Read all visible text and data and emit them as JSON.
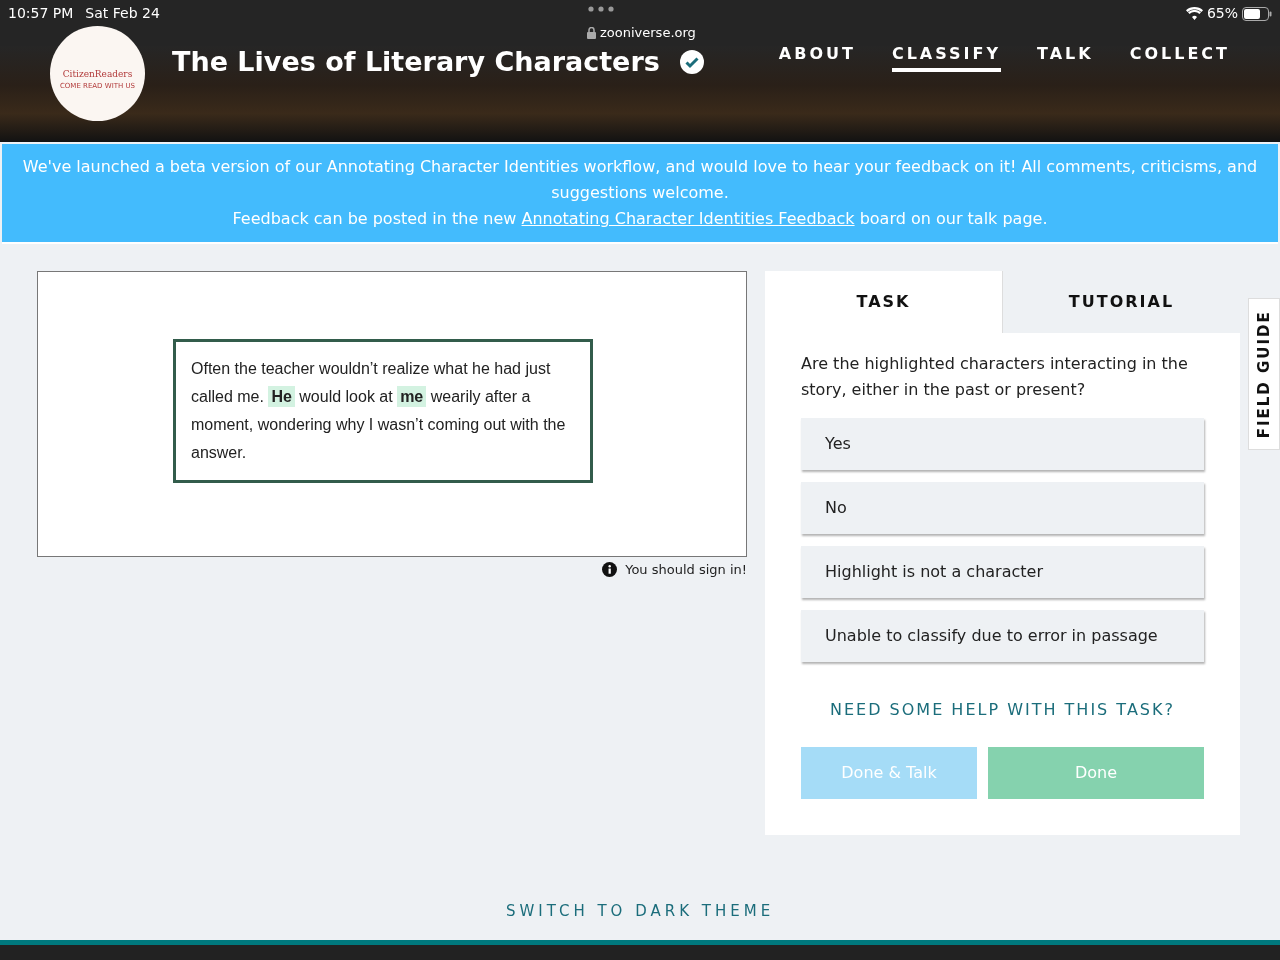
{
  "status_bar": {
    "time": "10:57 PM",
    "date": "Sat Feb 24",
    "url": "zooniverse.org",
    "battery": "65%"
  },
  "header": {
    "logo_name": "CitizenReaders",
    "logo_tagline": "COME READ WITH US",
    "title": "The Lives of Literary Characters",
    "nav": [
      {
        "label": "ABOUT",
        "selected": false
      },
      {
        "label": "CLASSIFY",
        "selected": true
      },
      {
        "label": "TALK",
        "selected": false
      },
      {
        "label": "COLLECT",
        "selected": false
      }
    ]
  },
  "banner": {
    "text": "We've launched a beta version of our Annotating Character Identities workflow, and would love to hear your feedback on it! All comments, criticisms, and suggestions welcome.",
    "line2_before": "Feedback can be posted in the new",
    "link": "Annotating Character Identities Feedback",
    "line2_after": "board on our talk page."
  },
  "passage": [
    {
      "text": "Often the teacher wouldn’t realize what he had just called me.",
      "highlighted": false
    },
    {
      "text": "He",
      "highlighted": true
    },
    {
      "text": "would look at",
      "highlighted": false
    },
    {
      "text": "me",
      "highlighted": true
    },
    {
      "text": "wearily after a moment, wondering why I wasn’t coming out with the answer.",
      "highlighted": false
    }
  ],
  "sign_in_note": "You should sign in!",
  "tabs": [
    {
      "label": "TASK",
      "selected": true
    },
    {
      "label": "TUTORIAL",
      "selected": false
    }
  ],
  "question": "Are the highlighted characters interacting in the story, either in the past or present?",
  "answers": [
    "Yes",
    "No",
    "Highlight is not a character",
    "Unable to classify due to error in passage"
  ],
  "help_link": "NEED SOME HELP WITH THIS TASK?",
  "buttons": [
    {
      "label": "Done & Talk",
      "disabled": true,
      "kind": "talk"
    },
    {
      "label": "Done",
      "disabled": true,
      "kind": "done"
    }
  ],
  "field_guide": "FIELD GUIDE",
  "theme_link": "SWITCH TO DARK THEME"
}
